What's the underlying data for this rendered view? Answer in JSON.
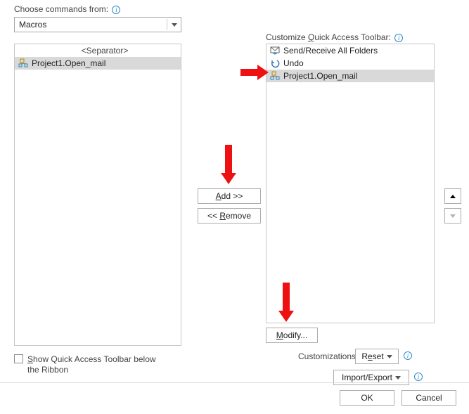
{
  "left": {
    "choose_label": "Choose commands from:",
    "source_dropdown": "Macros",
    "items": [
      {
        "label": "<Separator>",
        "icon": "separator"
      },
      {
        "label": "Project1.Open_mail",
        "icon": "macro",
        "selected": true
      }
    ],
    "show_below_ribbon": "Show Quick Access Toolbar below the Ribbon"
  },
  "middle": {
    "add": "Add >>",
    "remove": "<< Remove"
  },
  "right": {
    "customize_label": "Customize Quick Access Toolbar:",
    "items": [
      {
        "label": "Send/Receive All Folders",
        "icon": "sendreceive"
      },
      {
        "label": "Undo",
        "icon": "undo"
      },
      {
        "label": "Project1.Open_mail",
        "icon": "macro",
        "selected": true
      }
    ],
    "modify": "Modify...",
    "customizations_label": "Customizations:",
    "reset": "Reset",
    "import_export": "Import/Export"
  },
  "footer": {
    "ok": "OK",
    "cancel": "Cancel"
  }
}
